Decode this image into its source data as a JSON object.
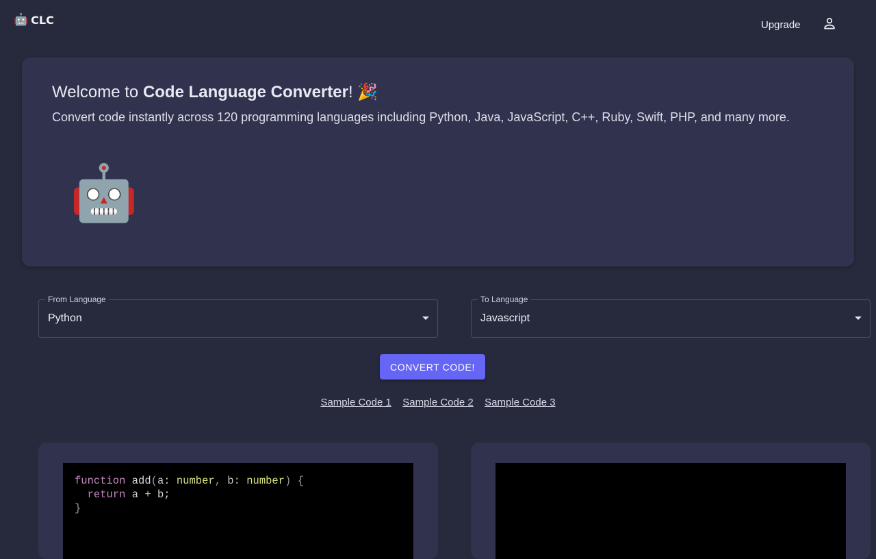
{
  "brand": {
    "emoji": "🤖",
    "name": "CLC"
  },
  "header": {
    "upgrade_label": "Upgrade",
    "user_icon": "user-icon"
  },
  "hero": {
    "title_prefix": "Welcome to ",
    "title_strong": "Code Language Converter",
    "title_suffix": "! 🎉",
    "subtitle": "Convert code instantly across 120 programming languages including Python, Java, JavaScript, C++, Ruby, Swift, PHP, and many more.",
    "robot": "🤖"
  },
  "from_language": {
    "label": "From Language",
    "value": "Python"
  },
  "to_language": {
    "label": "To Language",
    "value": "Javascript"
  },
  "convert_label": "CONVERT CODE!",
  "samples": [
    "Sample Code 1",
    "Sample Code 2",
    "Sample Code 3"
  ],
  "input_code": {
    "kw_function": "function",
    "fn_name": " add",
    "p_open": "(",
    "a": "a",
    "colon1": ": ",
    "t1": "number",
    "comma": ", ",
    "b": "b",
    "colon2": ": ",
    "t2": "number",
    "p_close": ") {",
    "indent": "  ",
    "kw_return": "return",
    "expr_a": " a ",
    "plus": "+",
    "expr_b": " b;",
    "brace": "}"
  },
  "output_code": ""
}
